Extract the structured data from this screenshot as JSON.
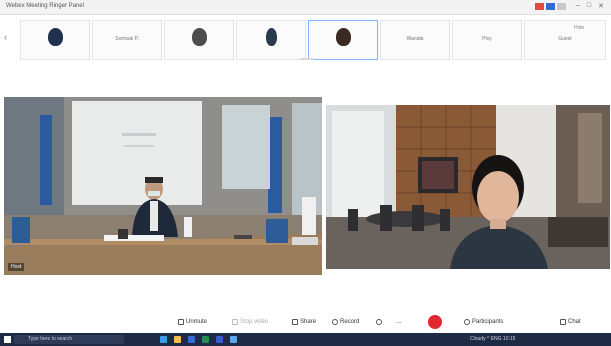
{
  "window": {
    "title": "Webex  Meeting  Ringer Panel"
  },
  "strip": {
    "hint": "Hide",
    "participants": [
      {
        "name": "",
        "avatar": "participant-avatar-1"
      },
      {
        "name": "Somsak P.",
        "avatar": ""
      },
      {
        "name": "",
        "avatar": "participant-avatar-3"
      },
      {
        "name": "",
        "avatar": "participant-avatar-4"
      },
      {
        "name": "",
        "avatar": "participant-avatar-5"
      },
      {
        "name": "Wanida",
        "avatar": ""
      },
      {
        "name": "Ploy",
        "avatar": ""
      },
      {
        "name": "Guest",
        "avatar": ""
      }
    ]
  },
  "videos": {
    "left": {
      "label": "Host"
    },
    "right": {
      "label": ""
    }
  },
  "toolbar": {
    "mute": "Unmute",
    "video": "Stop video",
    "share": "Share",
    "record": "Record",
    "reactions": "",
    "more": "...",
    "participants": "Participants",
    "chat": "Chat",
    "leave_color": "#e0282e"
  },
  "taskbar": {
    "search_placeholder": "Type here to search",
    "tray": "Cloudy  ^  ENG  10:15"
  },
  "colors": {
    "accent": "#2f6fd1",
    "danger": "#e04a3f"
  }
}
